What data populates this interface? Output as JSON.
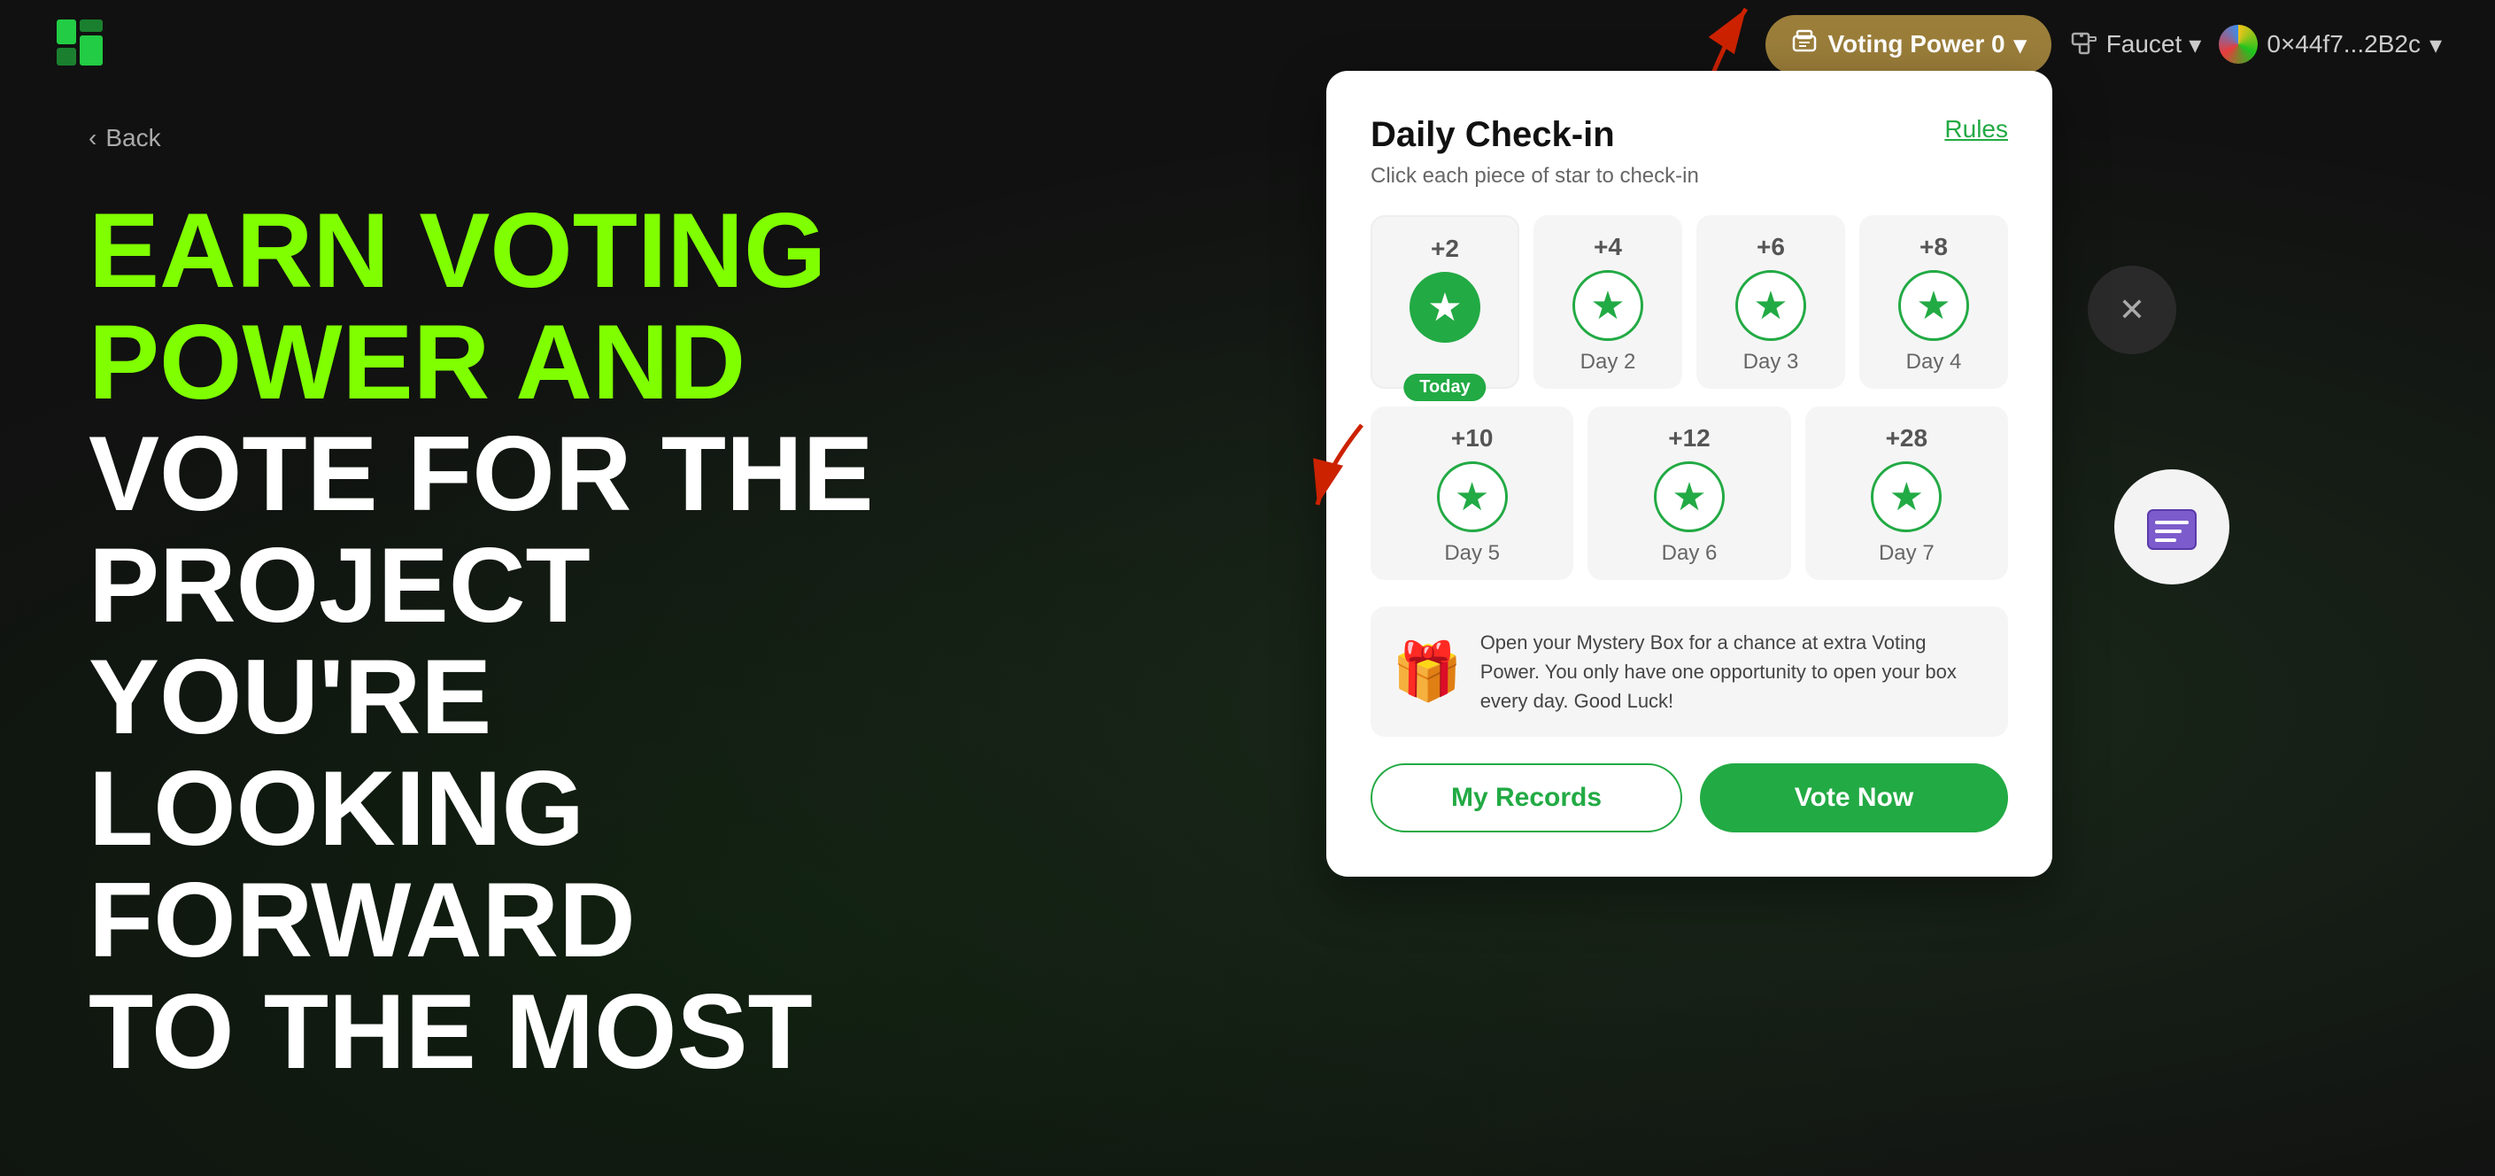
{
  "app": {
    "logo_alt": "App Logo"
  },
  "navbar": {
    "voting_power_label": "Voting Power 0",
    "faucet_label": "Faucet",
    "wallet_address": "0×44f7...2B2c"
  },
  "back": {
    "label": "Back"
  },
  "hero": {
    "line1": "EARN VOTING",
    "line2": "POWER AND",
    "line3": "VOTE FOR THE",
    "line4": "PROJECT YOU'RE",
    "line5": "LOOKING FORWARD",
    "line6": "TO THE MOST"
  },
  "modal": {
    "title": "Daily Check-in",
    "rules_label": "Rules",
    "subtitle": "Click each piece of star to check-in",
    "days": [
      {
        "points": "+2",
        "label": "Today",
        "is_today": true
      },
      {
        "points": "+4",
        "label": "Day 2",
        "is_today": false
      },
      {
        "points": "+6",
        "label": "Day 3",
        "is_today": false
      },
      {
        "points": "+8",
        "label": "Day 4",
        "is_today": false
      },
      {
        "points": "+10",
        "label": "Day 5",
        "is_today": false
      },
      {
        "points": "+12",
        "label": "Day 6",
        "is_today": false
      },
      {
        "points": "+28",
        "label": "Day 7",
        "is_today": false
      }
    ],
    "today_badge": "Today",
    "mystery_text": "Open your Mystery Box for a chance at extra Voting Power. You only have one opportunity to open your box every day. Good Luck!",
    "my_records_label": "My Records",
    "vote_now_label": "Vote Now"
  }
}
